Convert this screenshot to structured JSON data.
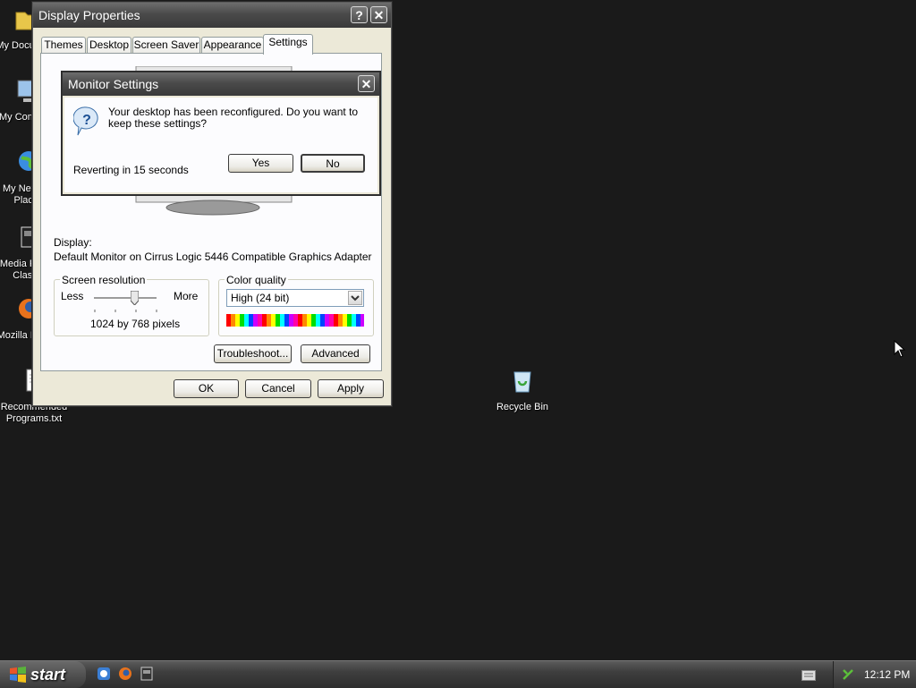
{
  "desktop": {
    "icons": [
      {
        "label": "My Documents"
      },
      {
        "label": "My Computer"
      },
      {
        "label": "My Network Places"
      },
      {
        "label": "Media Player Classic"
      },
      {
        "label": "Mozilla Firefox"
      },
      {
        "label": "Recommended Programs.txt"
      },
      {
        "label": "Recycle Bin"
      }
    ]
  },
  "display_properties": {
    "title": "Display Properties",
    "help_glyph": "?",
    "close_glyph": "✕",
    "tabs": [
      "Themes",
      "Desktop",
      "Screen Saver",
      "Appearance",
      "Settings"
    ],
    "active_tab": "Settings",
    "display_label": "Display:",
    "display_value": "Default Monitor on Cirrus Logic 5446 Compatible Graphics Adapter",
    "screen_resolution": {
      "title": "Screen resolution",
      "less": "Less",
      "more": "More",
      "value": "1024 by 768 pixels",
      "slider_level": 0.65
    },
    "color_quality": {
      "title": "Color quality",
      "selected": "High (24 bit)"
    },
    "buttons": {
      "troubleshoot": "Troubleshoot...",
      "advanced": "Advanced",
      "ok": "OK",
      "cancel": "Cancel",
      "apply": "Apply"
    }
  },
  "monitor_settings": {
    "title": "Monitor Settings",
    "close_glyph": "✕",
    "message": "Your desktop has been reconfigured.  Do you want to keep these settings?",
    "countdown": "Reverting in 15 seconds",
    "yes": "Yes",
    "no": "No"
  },
  "taskbar": {
    "start_label": "start",
    "clock": "12:12 PM"
  }
}
